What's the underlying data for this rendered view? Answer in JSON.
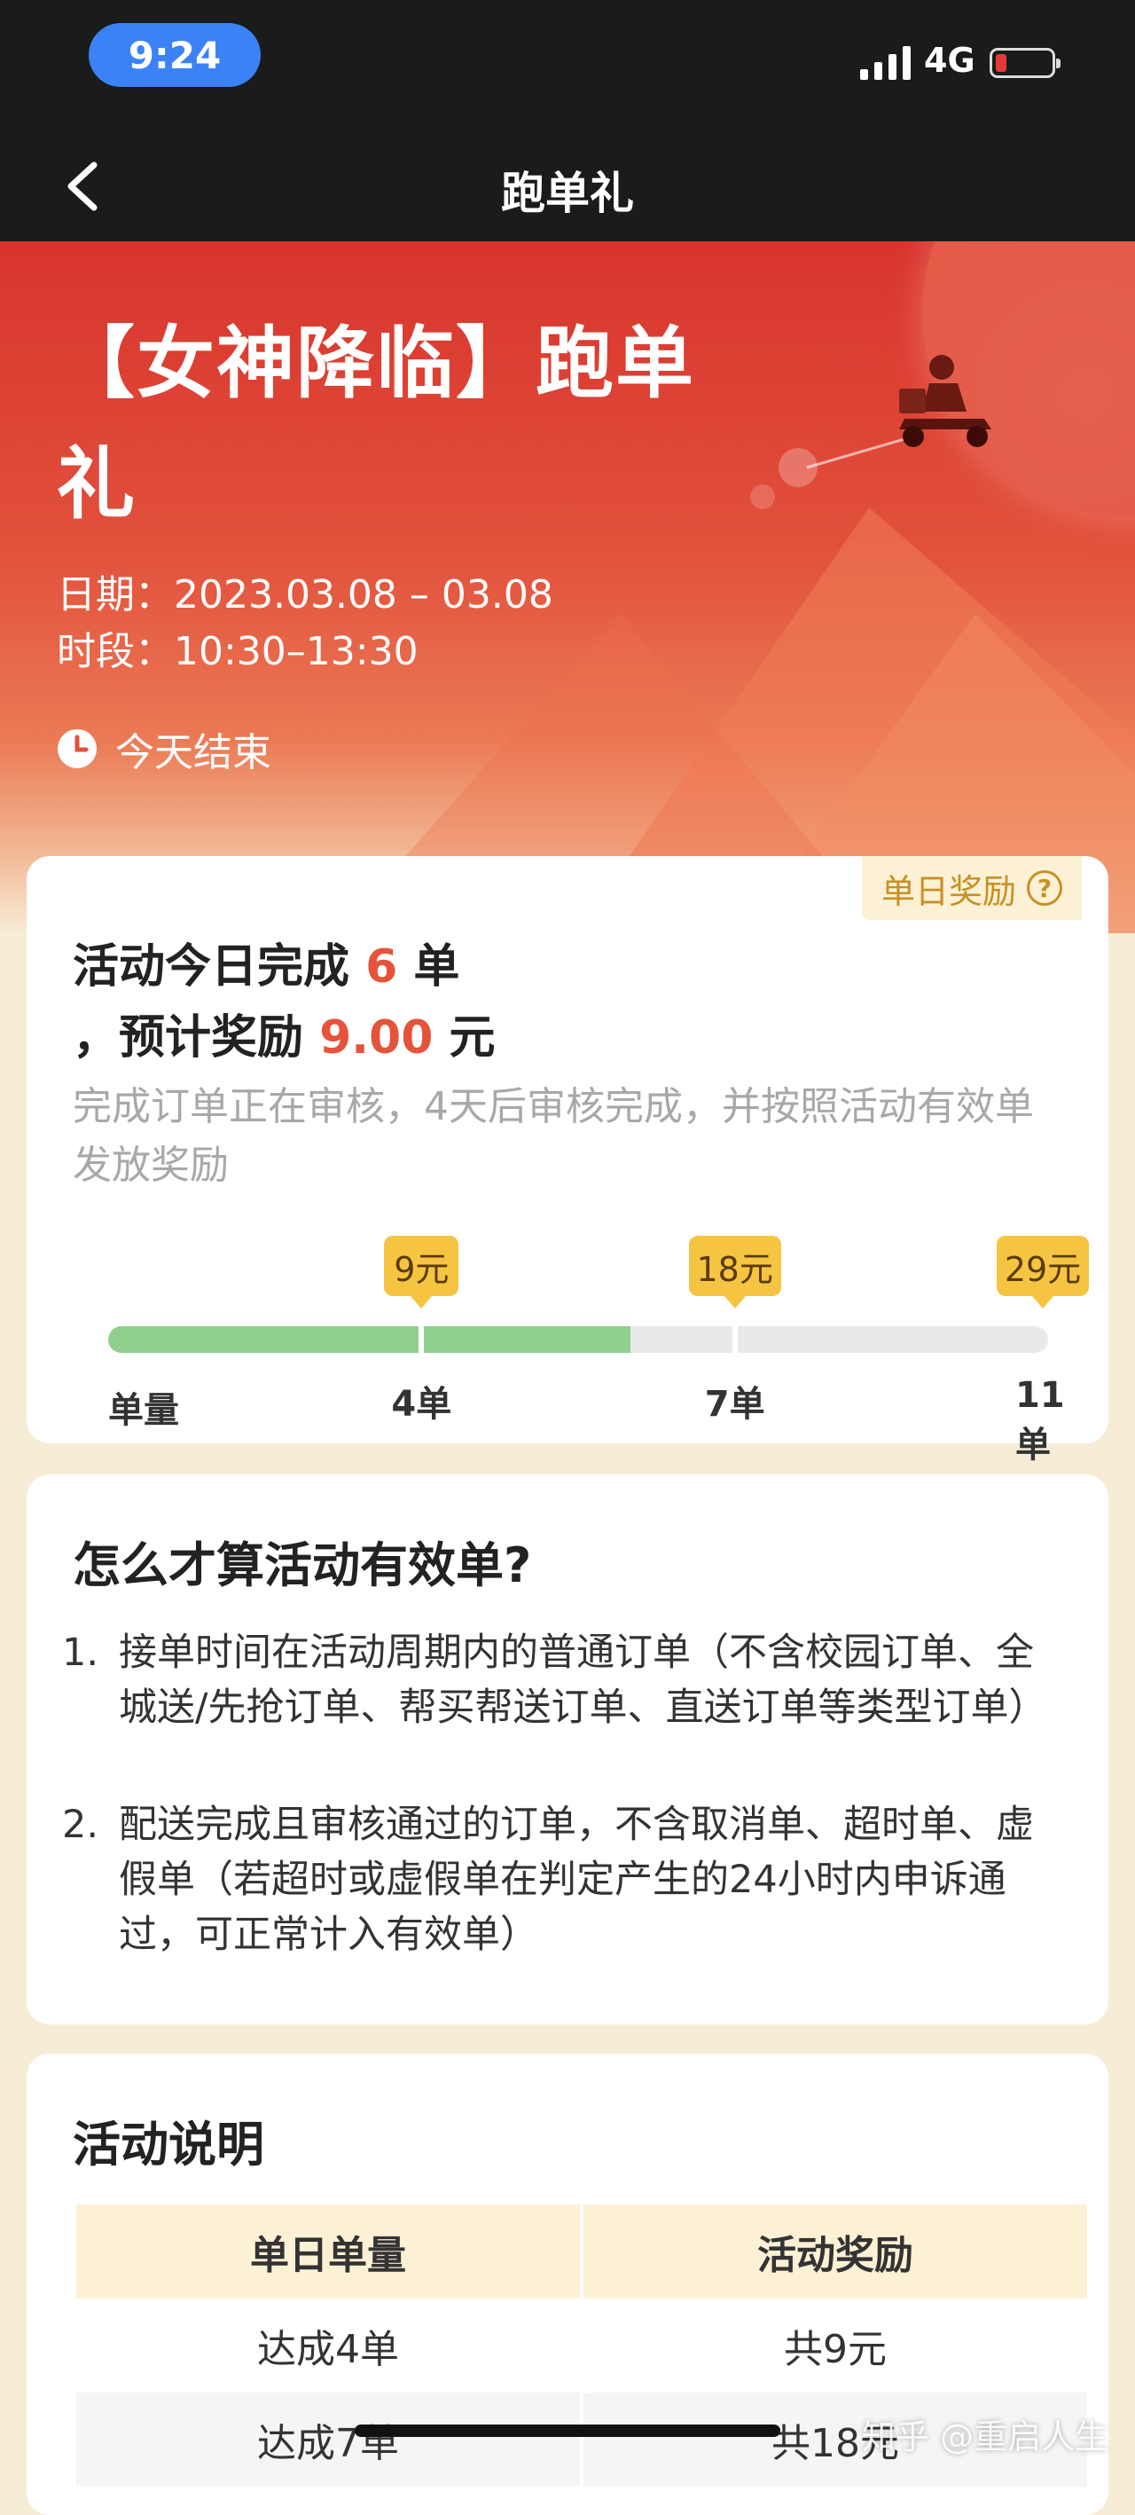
{
  "status_bar": {
    "time": "9:24",
    "network": "4G"
  },
  "nav": {
    "title": "跑单礼"
  },
  "hero": {
    "title": "【女神降临】跑单礼",
    "date": "日期：2023.03.08 – 03.08",
    "time": "时段：10:30–13:30",
    "end": "今天结束"
  },
  "summary": {
    "badge": "单日奖励",
    "line1_prefix": "活动今日完成 ",
    "orders": "6",
    "line1_suffix": " 单",
    "line2_prefix": "，预计奖励 ",
    "reward": "9.00",
    "line2_suffix": " 元",
    "audit_note": "完成订单正在审核，4天后审核完成，并按照活动有效单发放奖励"
  },
  "progress": {
    "x_label": "单量",
    "completed": 6,
    "max": 11,
    "milestones": [
      {
        "orders": 4,
        "label": "4单",
        "reward": "9元"
      },
      {
        "orders": 7,
        "label": "7单",
        "reward": "18元"
      },
      {
        "orders": 11,
        "label": "11单",
        "reward": "29元"
      }
    ]
  },
  "rules": {
    "title": "怎么才算活动有效单?",
    "items": [
      {
        "num": "1.",
        "text": "接单时间在活动周期内的普通订单（不含校园订单、全城送/先抢订单、帮买帮送订单、直送订单等类型订单）"
      },
      {
        "num": "2.",
        "text": "配送完成且审核通过的订单，不含取消单、超时单、虚假单（若超时或虚假单在判定产生的24小时内申诉通过，可正常计入有效单）"
      }
    ]
  },
  "description": {
    "title": "活动说明",
    "headers": [
      "单日单量",
      "活动奖励"
    ],
    "rows": [
      [
        "达成4单",
        "共9元"
      ],
      [
        "达成7单",
        "共18元"
      ]
    ]
  },
  "watermark": "知乎 @重启人生",
  "colors": {
    "accent_red": "#e5533b",
    "progress_green": "#8fd08f",
    "tag_yellow": "#f5c542",
    "badge_text": "#c69123"
  }
}
